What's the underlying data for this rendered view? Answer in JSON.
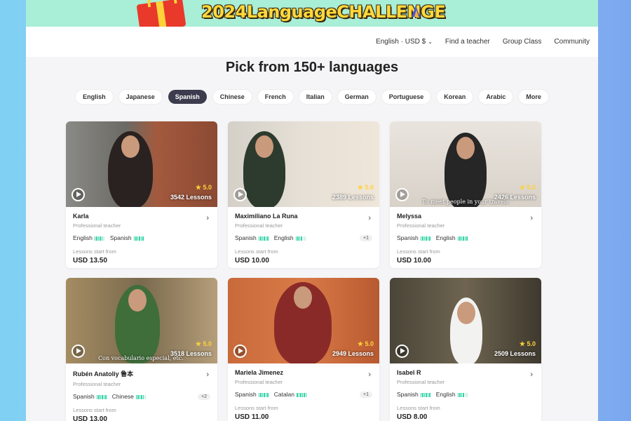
{
  "banner": {
    "title": "2024LanguageCHALLENGE"
  },
  "nav": {
    "locale": "English · USD $",
    "find_teacher": "Find a teacher",
    "group_class": "Group Class",
    "community": "Community"
  },
  "headline": "Pick from 150+ languages",
  "languages": [
    "English",
    "Japanese",
    "Spanish",
    "Chinese",
    "French",
    "Italian",
    "German",
    "Portuguese",
    "Korean",
    "Arabic",
    "More"
  ],
  "active_language": "Spanish",
  "lessons_from_label": "Lessons start from",
  "teachers": [
    {
      "name": "Karla",
      "role": "Professional teacher",
      "rating": "5.0",
      "lessons": "3542 Lessons",
      "languages": [
        {
          "name": "English",
          "level": 5
        },
        {
          "name": "Spanish",
          "level": 6
        }
      ],
      "extra": "",
      "price": "USD 13.50",
      "caption": ""
    },
    {
      "name": "Maximiliano La Runa",
      "role": "Professional teacher",
      "rating": "5.0",
      "lessons": "2389 Lessons",
      "languages": [
        {
          "name": "Spanish",
          "level": 6
        },
        {
          "name": "English",
          "level": 4
        }
      ],
      "extra": "+1",
      "price": "USD 10.00",
      "caption": ""
    },
    {
      "name": "Melyssa",
      "role": "Professional teacher",
      "rating": "5.0",
      "lessons": "2426 Lessons",
      "languages": [
        {
          "name": "Spanish",
          "level": 6
        },
        {
          "name": "English",
          "level": 6
        }
      ],
      "extra": "",
      "price": "USD 10.00",
      "caption": "To meet people in your travels"
    },
    {
      "name": "Rubén Anatoliy 鲁本",
      "role": "Professional teacher",
      "rating": "5.0",
      "lessons": "3518 Lessons",
      "languages": [
        {
          "name": "Spanish",
          "level": 6
        },
        {
          "name": "Chinese",
          "level": 5
        }
      ],
      "extra": "+2",
      "price": "USD 13.00",
      "caption": "Con vocabulario especial, etc."
    },
    {
      "name": "Mariela Jimenez",
      "role": "Professional teacher",
      "rating": "5.0",
      "lessons": "2949 Lessons",
      "languages": [
        {
          "name": "Spanish",
          "level": 6
        },
        {
          "name": "Catalan",
          "level": 6
        }
      ],
      "extra": "+1",
      "price": "USD 11.00",
      "caption": ""
    },
    {
      "name": "Isabel R",
      "role": "Professional teacher",
      "rating": "5.0",
      "lessons": "2509 Lessons",
      "languages": [
        {
          "name": "Spanish",
          "level": 6
        },
        {
          "name": "English",
          "level": 4
        }
      ],
      "extra": "",
      "price": "USD 8.00",
      "caption": ""
    }
  ],
  "colors": {
    "banner_bg": "#a9eed6",
    "active_pill": "#3c3c4e",
    "level_bar": "#2fd1a6",
    "star": "#ffd23a"
  }
}
